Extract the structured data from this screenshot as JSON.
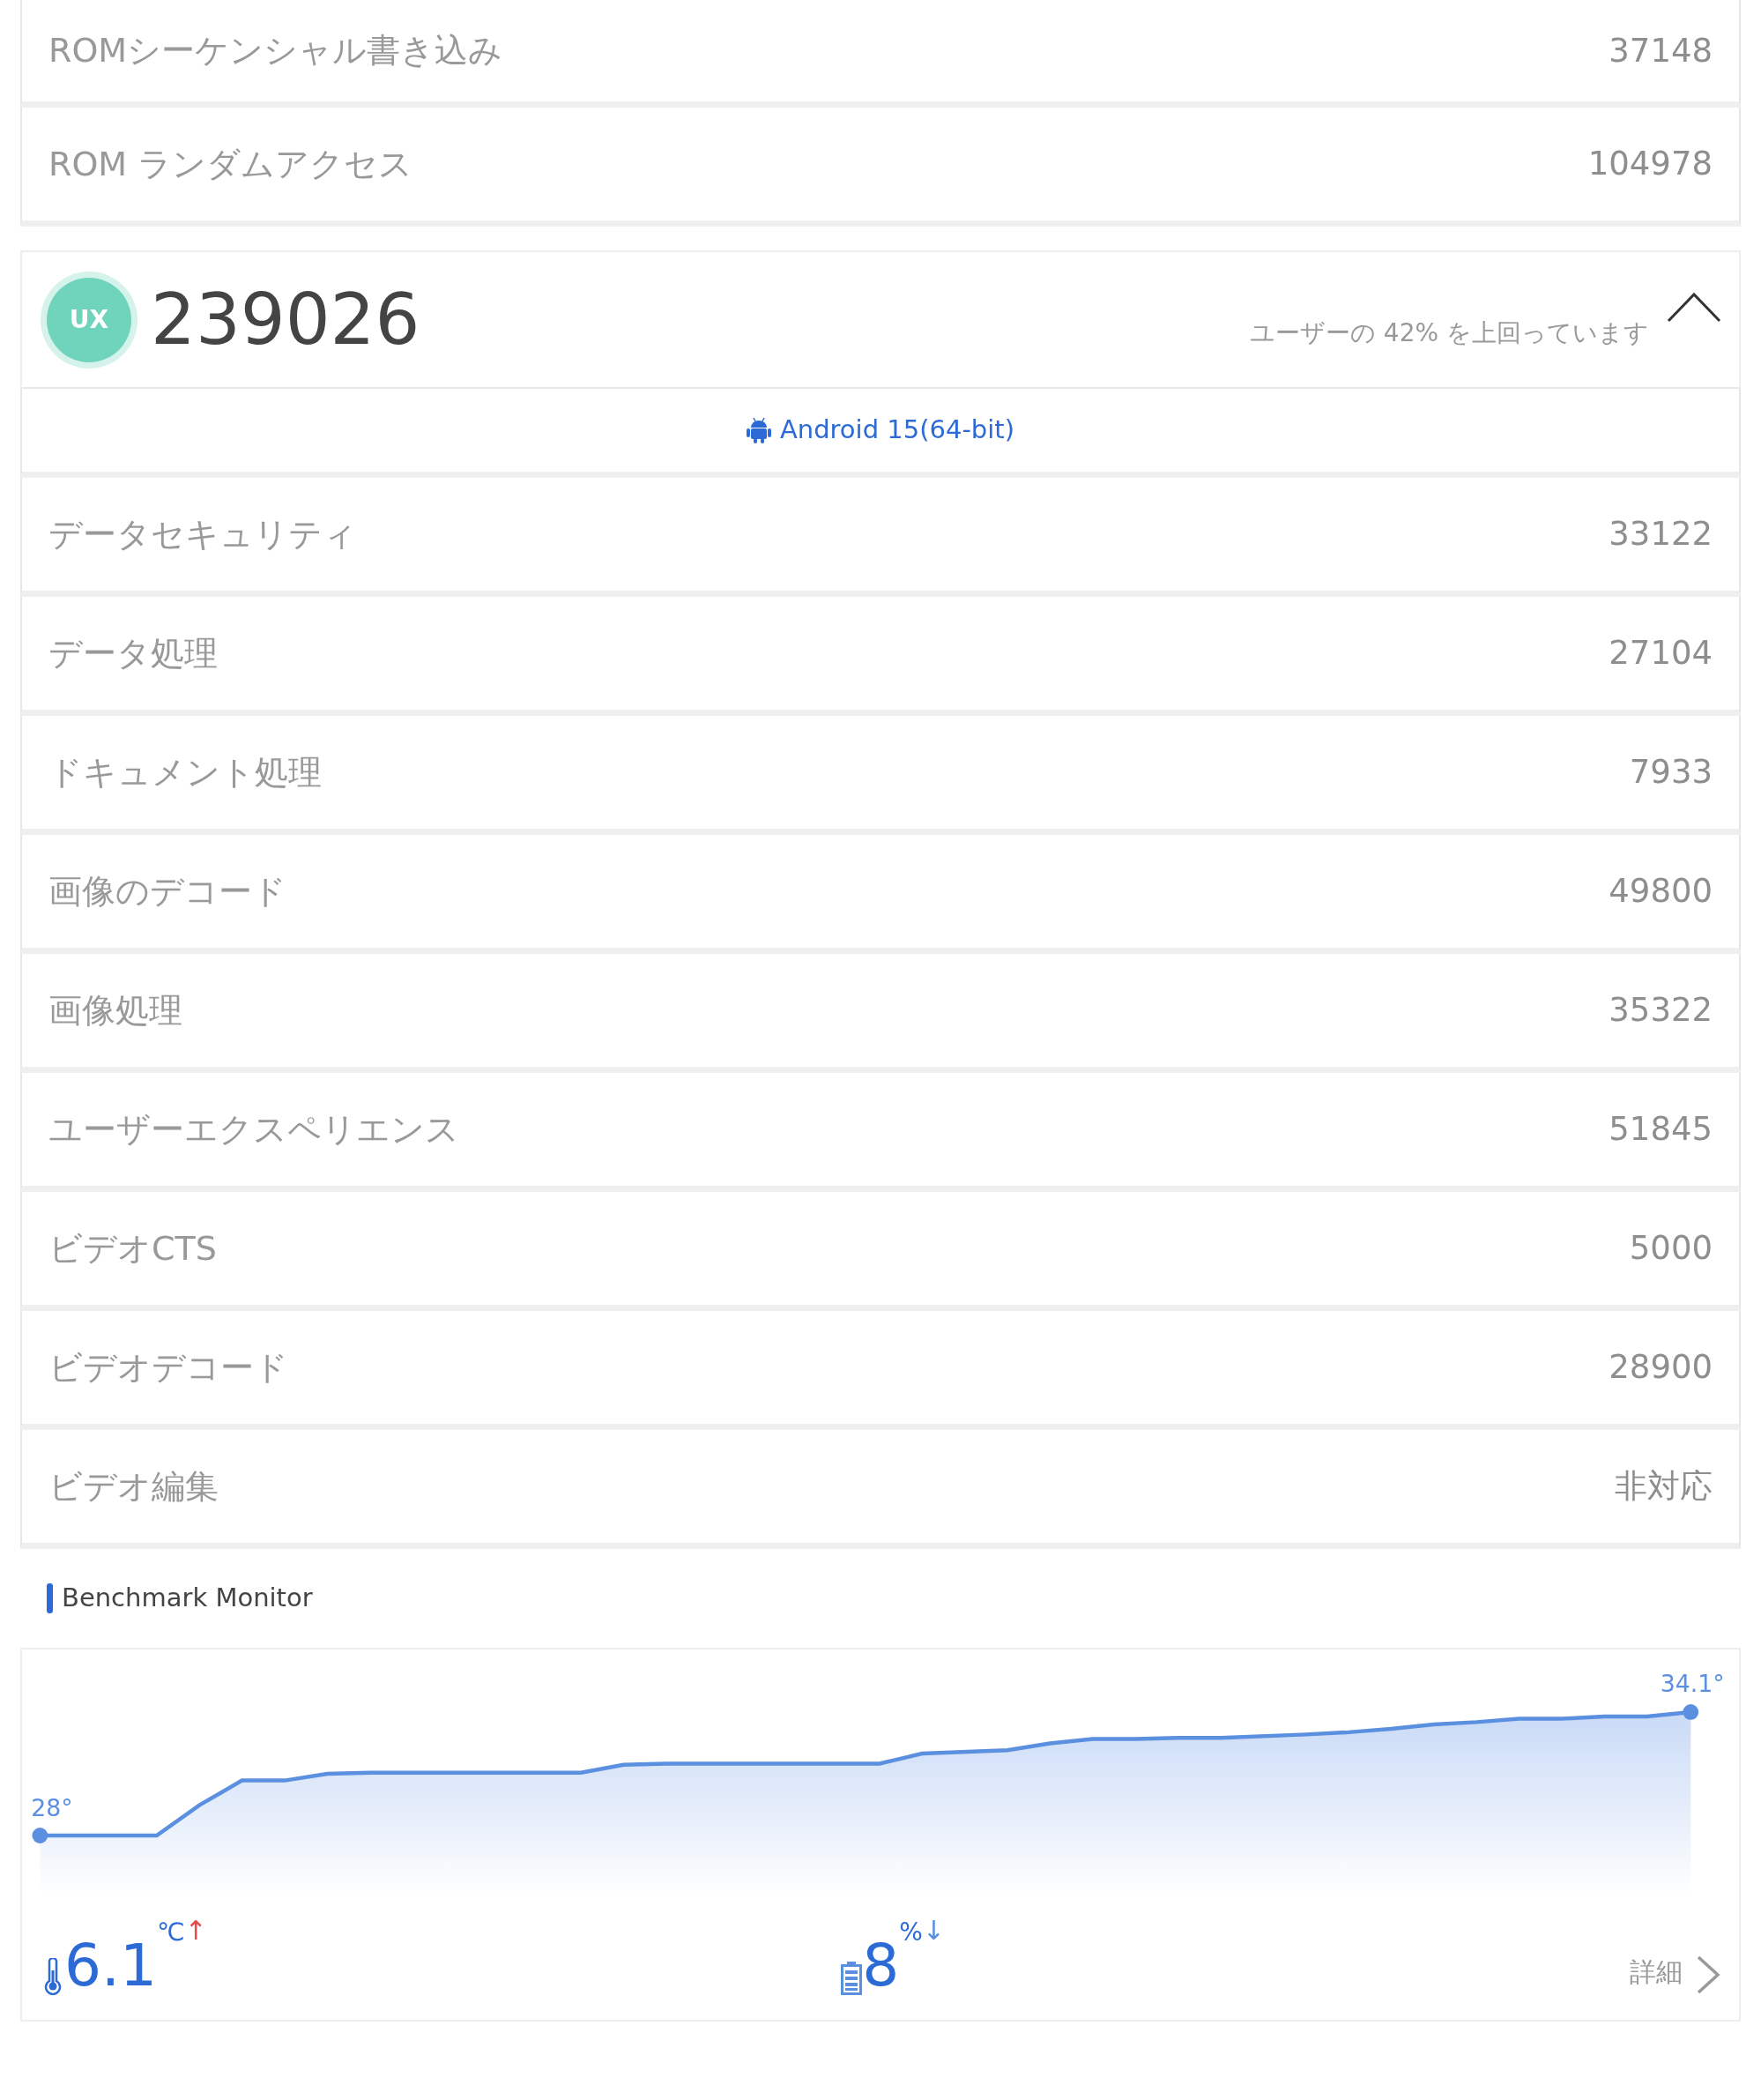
{
  "rows_top": [
    {
      "label": "ROMシーケンシャル書き込み",
      "value": "37148"
    },
    {
      "label": "ROM ランダムアクセス",
      "value": "104978"
    }
  ],
  "ux_score": {
    "badge": "UX",
    "score": "239026",
    "percentile_text": "ユーザーの 42% を上回っています",
    "expanded": true
  },
  "platform": "Android 15(64-bit)",
  "rows": [
    {
      "label": "データセキュリティ",
      "value": "33122"
    },
    {
      "label": "データ処理",
      "value": "27104"
    },
    {
      "label": "ドキュメント処理",
      "value": "7933"
    },
    {
      "label": "画像のデコード",
      "value": "49800"
    },
    {
      "label": "画像処理",
      "value": "35322"
    },
    {
      "label": "ユーザーエクスペリエンス",
      "value": "51845"
    },
    {
      "label": "ビデオCTS",
      "value": "5000"
    },
    {
      "label": "ビデオデコード",
      "value": "28900"
    },
    {
      "label": "ビデオ編集",
      "value": "非対応"
    }
  ],
  "monitor": {
    "title": "Benchmark Monitor",
    "start_label": "28°",
    "end_label": "34.1°",
    "temperature": {
      "value": "6.1",
      "unit": "℃",
      "trend": "↑"
    },
    "battery": {
      "value": "8",
      "unit": "%",
      "trend": "↓"
    },
    "details": "詳細"
  }
}
